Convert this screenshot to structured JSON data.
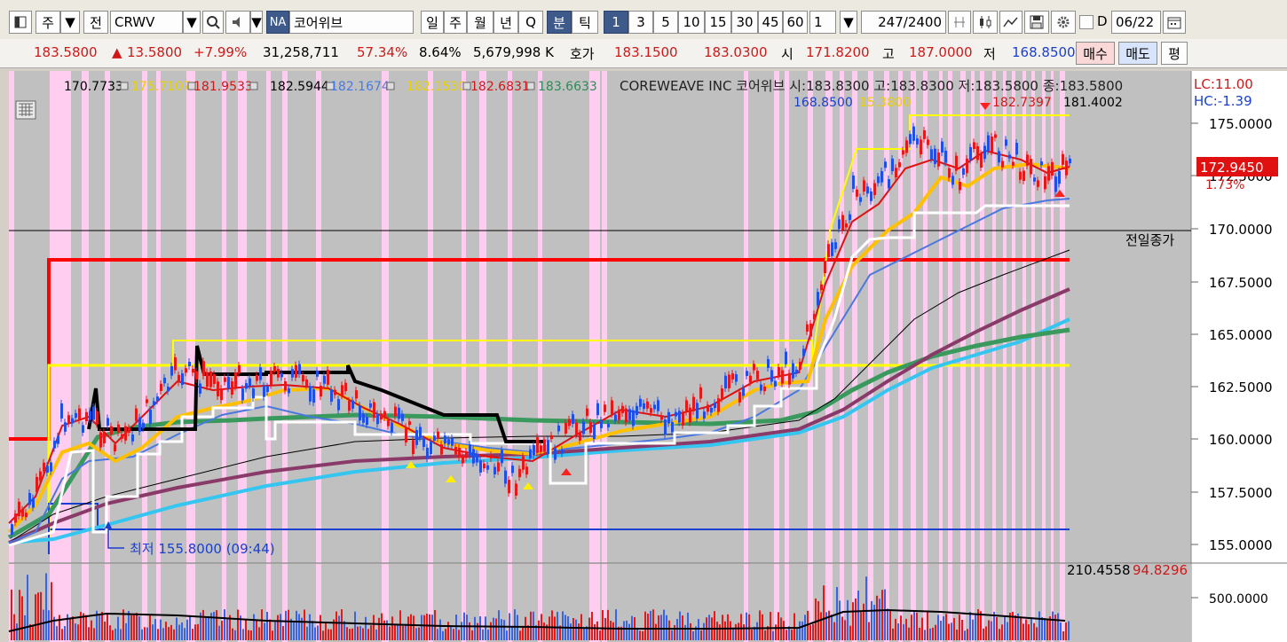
{
  "toolbar": {
    "menu_label": "주",
    "mode_label": "전",
    "symbol": "CRWV",
    "market_tag": "NA",
    "stock_name": "코어위브",
    "periods": [
      "일",
      "주",
      "월",
      "년",
      "Q",
      "분",
      "틱"
    ],
    "active_period": "분",
    "intervals": [
      "1",
      "3",
      "5",
      "10",
      "15",
      "30",
      "45",
      "60"
    ],
    "active_interval": "1",
    "interval_value": "1",
    "bar_count": "247",
    "bar_total": "/2400",
    "date_checkbox_label": "D",
    "date_value": "06/22"
  },
  "quote": {
    "price": "183.5800",
    "change": "13.5800",
    "change_pct": "+7.99%",
    "volume": "31,258,711",
    "ratio1": "57.34%",
    "ratio2": "8.64%",
    "amount": "5,679,998 K",
    "hoga_label": "호가",
    "bid": "183.1500",
    "ask": "183.0300",
    "open_label": "시",
    "open": "171.8200",
    "high_label": "고",
    "high": "187.0000",
    "low_label": "저",
    "low": "168.8500",
    "buy_label": "매수",
    "sell_label": "매도",
    "avg_label": "평"
  },
  "chart": {
    "legend_values": [
      {
        "text": "170.7733",
        "color": "#000000"
      },
      {
        "text": "175.7107",
        "color": "#e8d000"
      },
      {
        "text": "181.9533",
        "color": "#d01818"
      },
      {
        "text": "182.5944",
        "color": "#000000"
      },
      {
        "text": "182.1674",
        "color": "#4a7adf"
      },
      {
        "text": "182.1530",
        "color": "#e8d000"
      },
      {
        "text": "182.6831",
        "color": "#d01818"
      },
      {
        "text": "183.6633",
        "color": "#2e8b57"
      }
    ],
    "name_line": "COREWEAVE INC  코어위브 시:183.8300 고:183.8300 저:183.5800 종:183.5800",
    "legend2": [
      {
        "text": "168.8500",
        "color": "#1a3fd0"
      },
      {
        "text": "15.3800",
        "color": "#e8d000"
      },
      {
        "text": "182.7397",
        "color": "#d01818"
      },
      {
        "text": "181.4002",
        "color": "#000000"
      }
    ],
    "lc_label": "LC:11.00",
    "hc_label": "HC:-1.39",
    "current_price": "172.9450",
    "current_pct": "1.73%",
    "prev_close_label": "전일종가",
    "low_marker": "최저 155.8000 (09:44)",
    "volume_values": [
      {
        "text": "210.4558",
        "color": "#000000"
      },
      {
        "text": "94.8296",
        "color": "#d01818"
      }
    ],
    "y_ticks": [
      "175.0000",
      "172.5000",
      "170.0000",
      "167.5000",
      "165.0000",
      "162.5000",
      "160.0000",
      "157.5000",
      "155.0000"
    ],
    "vol_tick": "500.0000"
  }
}
